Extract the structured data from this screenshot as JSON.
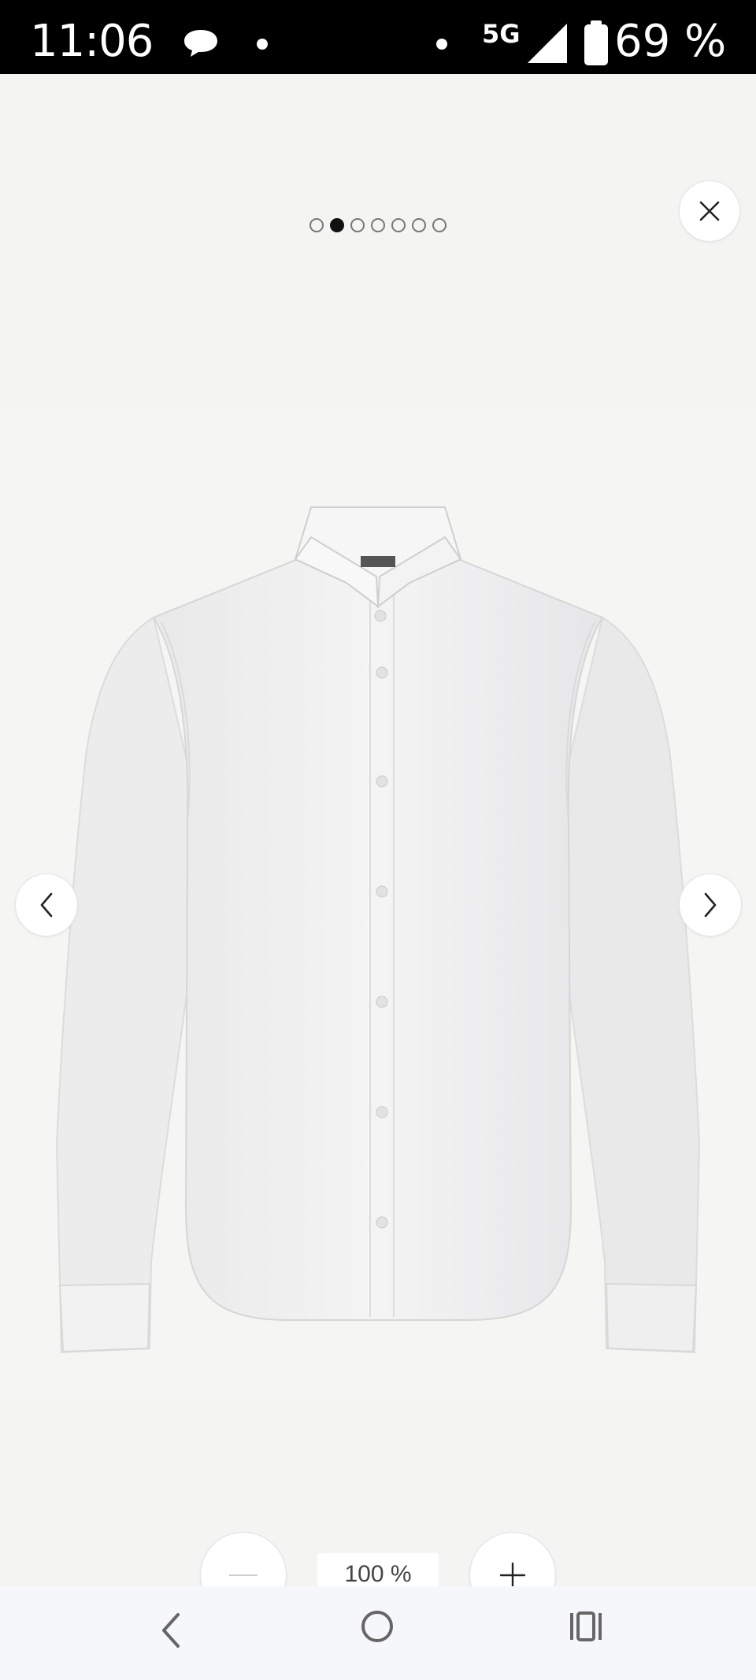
{
  "status_bar": {
    "time": "11:06",
    "network": "5G",
    "battery": "69 %",
    "icons": [
      "message-bubble-icon",
      "notification-dot-icon",
      "notification-dot-icon",
      "signal-icon",
      "battery-icon"
    ]
  },
  "viewer": {
    "pager": {
      "total": 7,
      "active_index": 1
    },
    "close_icon": "close-icon",
    "prev_icon": "chevron-left-icon",
    "next_icon": "chevron-right-icon",
    "product_image": "white-long-sleeve-shirt"
  },
  "zoom": {
    "level": "100 %",
    "zoom_out_icon": "minus-icon",
    "zoom_in_icon": "plus-icon"
  },
  "nav_bar": {
    "icons": [
      "back-icon",
      "home-icon",
      "recent-apps-icon"
    ]
  },
  "colors": {
    "background": "#f4f4f3",
    "status_bar": "#000000",
    "active_dot": "#111111",
    "button_bg": "#ffffff"
  }
}
